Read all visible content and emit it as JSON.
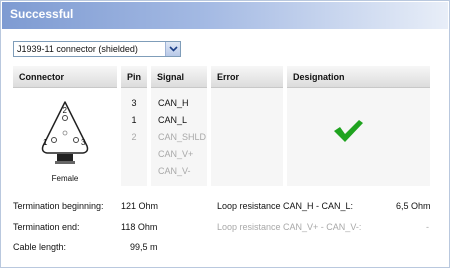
{
  "title": "Successful",
  "connector_select": {
    "value": "J1939-11 connector (shielded)"
  },
  "columns": {
    "connector": "Connector",
    "pin": "Pin",
    "signal": "Signal",
    "error": "Error",
    "designation": "Designation"
  },
  "connector": {
    "pin_labels": [
      "1",
      "2",
      "3"
    ],
    "caption": "Female"
  },
  "rows": [
    {
      "pin": "3",
      "signal": "CAN_H",
      "active": true
    },
    {
      "pin": "1",
      "signal": "CAN_L",
      "active": true
    },
    {
      "pin": "2",
      "signal": "CAN_SHLD",
      "active": false
    },
    {
      "pin": "",
      "signal": "CAN_V+",
      "active": false
    },
    {
      "pin": "",
      "signal": "CAN_V-",
      "active": false
    }
  ],
  "designation_icon": "green-checkmark-icon",
  "colors": {
    "check": "#1fa31f",
    "title_bar": "#7e9bd2"
  },
  "measurements": {
    "termination_beginning": {
      "label": "Termination beginning:",
      "value": "121 Ohm"
    },
    "termination_end": {
      "label": "Termination end:",
      "value": "118 Ohm"
    },
    "cable_length": {
      "label": "Cable length:",
      "value": "99,5 m"
    },
    "loop_resistance_can": {
      "label": "Loop resistance CAN_H - CAN_L:",
      "value": "6,5 Ohm"
    },
    "loop_resistance_v": {
      "label": "Loop resistance CAN_V+ - CAN_V-:",
      "value": "-"
    }
  }
}
